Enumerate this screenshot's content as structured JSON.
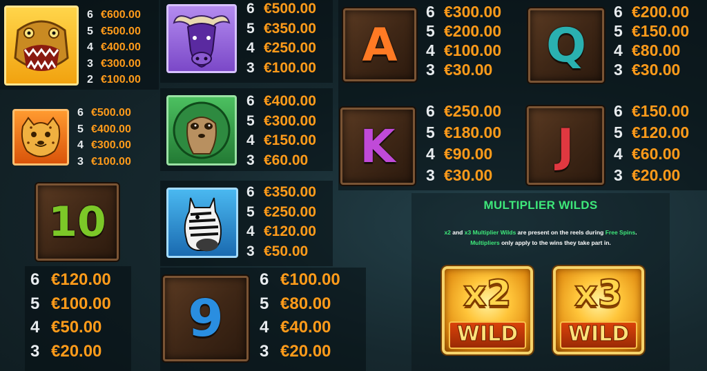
{
  "colors": {
    "count": "#e8ecef",
    "amount": "#ff9b1a",
    "highlight": "#3ee87a"
  },
  "symbols": {
    "crocodile": {
      "icon": "crocodile-icon",
      "pays": [
        {
          "count": "6",
          "amount": "€600.00"
        },
        {
          "count": "5",
          "amount": "€500.00"
        },
        {
          "count": "4",
          "amount": "€400.00"
        },
        {
          "count": "3",
          "amount": "€300.00"
        },
        {
          "count": "2",
          "amount": "€100.00"
        }
      ]
    },
    "buffalo": {
      "icon": "buffalo-icon",
      "pays": [
        {
          "count": "6",
          "amount": "€500.00"
        },
        {
          "count": "5",
          "amount": "€350.00"
        },
        {
          "count": "4",
          "amount": "€250.00"
        },
        {
          "count": "3",
          "amount": "€100.00"
        }
      ]
    },
    "a": {
      "letter": "A",
      "pays": [
        {
          "count": "6",
          "amount": "€300.00"
        },
        {
          "count": "5",
          "amount": "€200.00"
        },
        {
          "count": "4",
          "amount": "€100.00"
        },
        {
          "count": "3",
          "amount": "€30.00"
        }
      ]
    },
    "q": {
      "letter": "Q",
      "pays": [
        {
          "count": "6",
          "amount": "€200.00"
        },
        {
          "count": "5",
          "amount": "€150.00"
        },
        {
          "count": "4",
          "amount": "€80.00"
        },
        {
          "count": "3",
          "amount": "€30.00"
        }
      ]
    },
    "cheetah": {
      "icon": "cheetah-icon",
      "pays": [
        {
          "count": "6",
          "amount": "€500.00"
        },
        {
          "count": "5",
          "amount": "€400.00"
        },
        {
          "count": "4",
          "amount": "€300.00"
        },
        {
          "count": "3",
          "amount": "€100.00"
        }
      ]
    },
    "meerkat": {
      "icon": "meerkat-icon",
      "pays": [
        {
          "count": "6",
          "amount": "€400.00"
        },
        {
          "count": "5",
          "amount": "€300.00"
        },
        {
          "count": "4",
          "amount": "€150.00"
        },
        {
          "count": "3",
          "amount": "€60.00"
        }
      ]
    },
    "k": {
      "letter": "K",
      "pays": [
        {
          "count": "6",
          "amount": "€250.00"
        },
        {
          "count": "5",
          "amount": "€180.00"
        },
        {
          "count": "4",
          "amount": "€90.00"
        },
        {
          "count": "3",
          "amount": "€30.00"
        }
      ]
    },
    "j": {
      "letter": "J",
      "pays": [
        {
          "count": "6",
          "amount": "€150.00"
        },
        {
          "count": "5",
          "amount": "€120.00"
        },
        {
          "count": "4",
          "amount": "€60.00"
        },
        {
          "count": "3",
          "amount": "€20.00"
        }
      ]
    },
    "zebra": {
      "icon": "zebra-icon",
      "pays": [
        {
          "count": "6",
          "amount": "€350.00"
        },
        {
          "count": "5",
          "amount": "€250.00"
        },
        {
          "count": "4",
          "amount": "€120.00"
        },
        {
          "count": "3",
          "amount": "€50.00"
        }
      ]
    },
    "ten": {
      "letter": "10",
      "pays": [
        {
          "count": "6",
          "amount": "€120.00"
        },
        {
          "count": "5",
          "amount": "€100.00"
        },
        {
          "count": "4",
          "amount": "€50.00"
        },
        {
          "count": "3",
          "amount": "€20.00"
        }
      ]
    },
    "nine": {
      "letter": "9",
      "pays": [
        {
          "count": "6",
          "amount": "€100.00"
        },
        {
          "count": "5",
          "amount": "€80.00"
        },
        {
          "count": "4",
          "amount": "€40.00"
        },
        {
          "count": "3",
          "amount": "€20.00"
        }
      ]
    }
  },
  "multiplier_wilds": {
    "title": "MULTIPLIER WILDS",
    "line1_a": "x2",
    "line1_b": " and ",
    "line1_c": "x3 Multiplier Wilds",
    "line1_d": " are present on the reels during ",
    "line1_e": "Free Spins",
    "line1_f": ".",
    "line2_a": "Multipliers",
    "line2_b": " only apply to the wins they take part in.",
    "wilds": [
      {
        "multiplier": "x2",
        "label": "WILD"
      },
      {
        "multiplier": "x3",
        "label": "WILD"
      }
    ]
  }
}
